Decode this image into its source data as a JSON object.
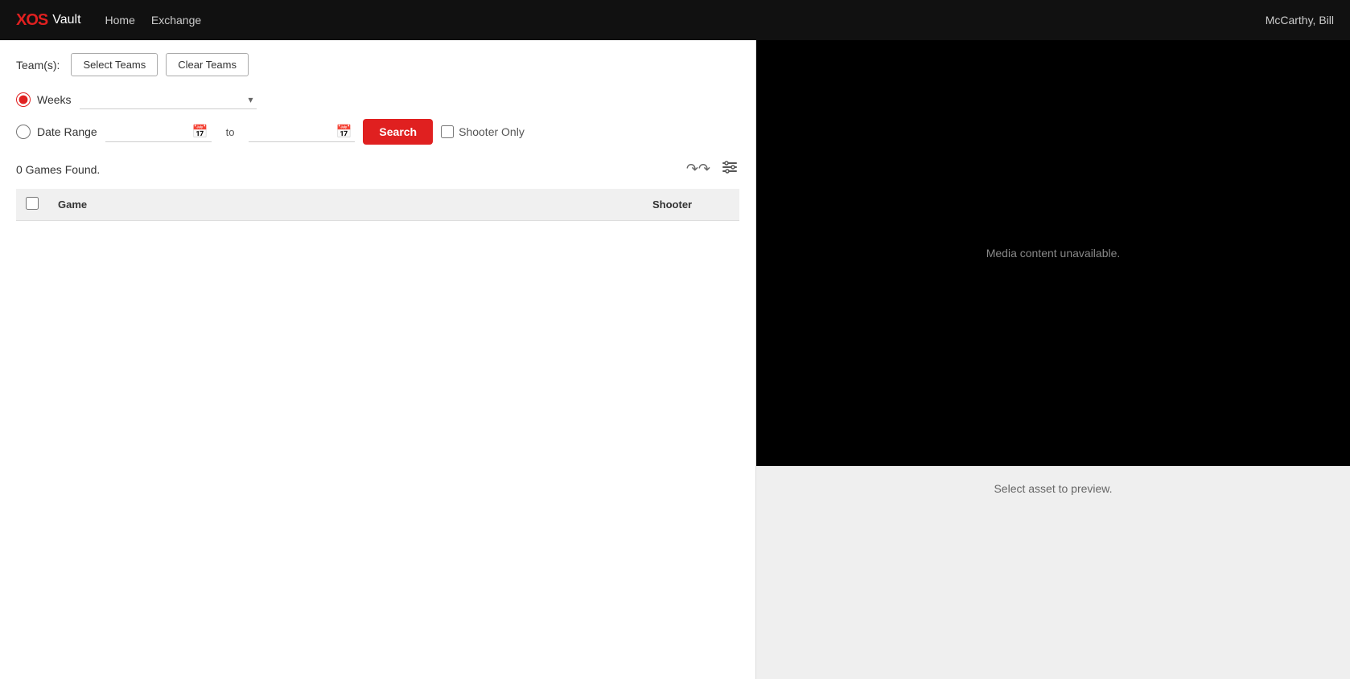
{
  "navbar": {
    "logo_xo": "XO",
    "logo_s": "S",
    "vault": "Vault",
    "home": "Home",
    "exchange": "Exchange",
    "user": "McCarthy, Bill"
  },
  "teams": {
    "label": "Team(s):",
    "select_btn": "Select Teams",
    "clear_btn": "Clear Teams"
  },
  "filter": {
    "weeks_radio_label": "Weeks",
    "date_range_radio_label": "Date Range",
    "weeks_placeholder": "",
    "date_from_placeholder": "",
    "date_to_label": "to",
    "date_to_placeholder": "",
    "search_btn": "Search",
    "shooter_only_label": "Shooter Only"
  },
  "results": {
    "count_text": "0 Games Found.",
    "share_icon": "↬↬",
    "settings_icon": "⚙"
  },
  "table": {
    "col_game": "Game",
    "col_shooter": "Shooter",
    "rows": []
  },
  "preview": {
    "media_unavailable": "Media content unavailable.",
    "select_asset": "Select asset to preview."
  }
}
